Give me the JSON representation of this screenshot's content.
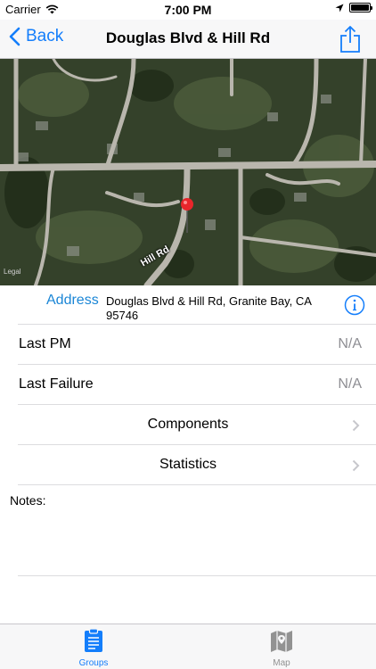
{
  "status_bar": {
    "carrier": "Carrier",
    "time": "7:00 PM",
    "wifi_icon": "wifi-icon",
    "location_icon": "location-arrow-icon",
    "battery_icon": "battery-icon",
    "battery_level": 1.0
  },
  "nav": {
    "back_label": "Back",
    "title": "Douglas Blvd & Hill Rd",
    "share_icon": "share-icon",
    "tint_color": "#147efb"
  },
  "map": {
    "road_label": "Hill Rd",
    "legal_label": "Legal",
    "pin_icon": "map-pin-icon",
    "pin_color": "#e8262b"
  },
  "details": {
    "address_label": "Address",
    "address_value": "Douglas Blvd & Hill Rd, Granite Bay, CA 95746",
    "info_icon": "info-icon",
    "last_pm_label": "Last PM",
    "last_pm_value": "N/A",
    "last_failure_label": "Last Failure",
    "last_failure_value": "N/A",
    "components_label": "Components",
    "statistics_label": "Statistics",
    "notes_label": "Notes:"
  },
  "tab_bar": {
    "tabs": [
      {
        "label": "Groups",
        "icon": "clipboard-icon",
        "selected": true
      },
      {
        "label": "Map",
        "icon": "map-icon",
        "selected": false
      }
    ]
  }
}
